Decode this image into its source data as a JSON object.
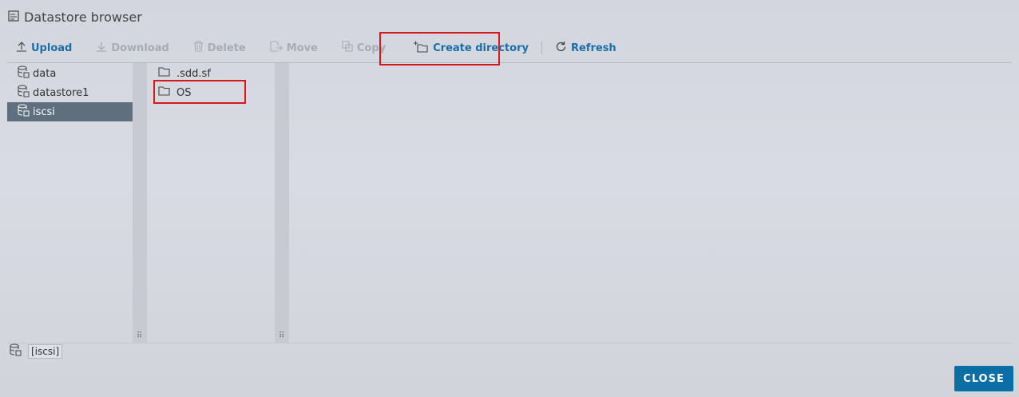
{
  "window": {
    "title": "Datastore browser",
    "icon": "datastore-browser-icon"
  },
  "toolbar": {
    "upload": "Upload",
    "download": "Download",
    "delete": "Delete",
    "move": "Move",
    "copy": "Copy",
    "create_directory": "Create directory",
    "refresh": "Refresh"
  },
  "datastores": [
    {
      "label": "data",
      "selected": false
    },
    {
      "label": "datastore1",
      "selected": false
    },
    {
      "label": "iscsi",
      "selected": true
    }
  ],
  "folders": [
    {
      "label": ".sdd.sf"
    },
    {
      "label": "OS"
    }
  ],
  "status": {
    "current_path": "[iscsi]"
  },
  "footer": {
    "close_label": "CLOSE"
  },
  "colors": {
    "accent": "#1a6fa8",
    "selected_bg": "#5f6f7d",
    "highlight": "#d21a1a",
    "primary_button": "#0b6fa6"
  }
}
